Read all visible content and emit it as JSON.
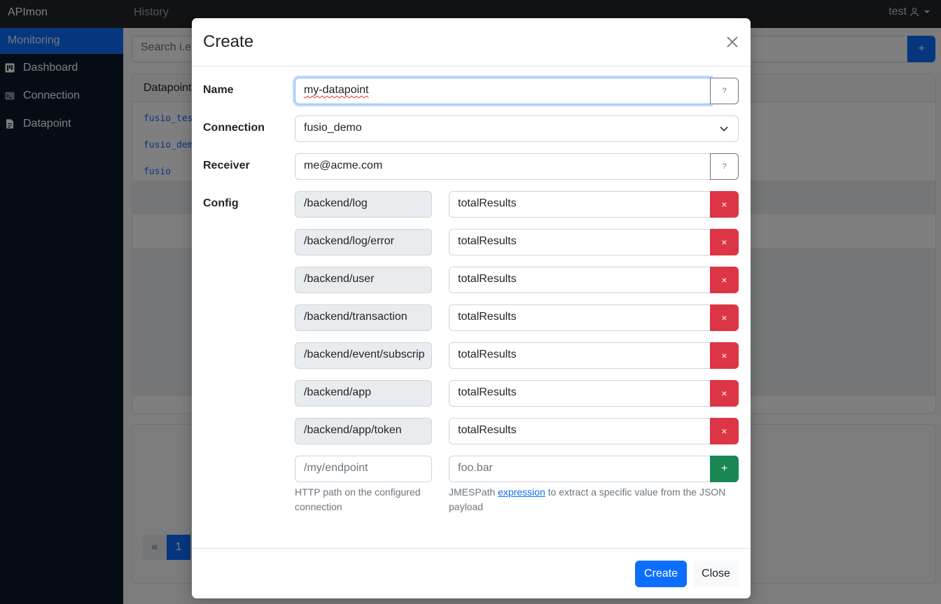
{
  "app": {
    "brand": "APImon",
    "nav_history": "History",
    "user": "test"
  },
  "sidebar": {
    "header": "Monitoring",
    "items": [
      {
        "label": "Dashboard",
        "icon": "dashboard-icon"
      },
      {
        "label": "Connection",
        "icon": "terminal-icon"
      },
      {
        "label": "Datapoint",
        "icon": "document-icon"
      }
    ]
  },
  "main": {
    "search_placeholder": "Search i.e",
    "add_label": "+",
    "card_title": "Datapoint",
    "list": [
      "fusio_tes",
      "fusio_dem",
      "fusio"
    ],
    "pager_prev": "«",
    "pager_page": "1"
  },
  "modal": {
    "title": "Create",
    "name": {
      "label": "Name",
      "value": "my-datapoint",
      "help_label": "?"
    },
    "connection": {
      "label": "Connection",
      "value": "fusio_demo"
    },
    "receiver": {
      "label": "Receiver",
      "value": "me@acme.com",
      "help_label": "?"
    },
    "config": {
      "label": "Config",
      "rows": [
        {
          "path": "/backend/log",
          "expr": "totalResults"
        },
        {
          "path": "/backend/log/error",
          "expr": "totalResults"
        },
        {
          "path": "/backend/user",
          "expr": "totalResults"
        },
        {
          "path": "/backend/transaction",
          "expr": "totalResults"
        },
        {
          "path": "/backend/event/subscrip",
          "expr": "totalResults"
        },
        {
          "path": "/backend/app",
          "expr": "totalResults"
        },
        {
          "path": "/backend/app/token",
          "expr": "totalResults"
        }
      ],
      "remove_label": "×",
      "new_path_placeholder": "/my/endpoint",
      "new_expr_placeholder": "foo.bar",
      "add_label": "+",
      "path_help": "HTTP path on the configured connection",
      "expr_help_before": "JMESPath ",
      "expr_help_link": "expression",
      "expr_help_after": " to extract a specific value from the JSON payload"
    },
    "create_button": "Create",
    "close_button": "Close"
  }
}
